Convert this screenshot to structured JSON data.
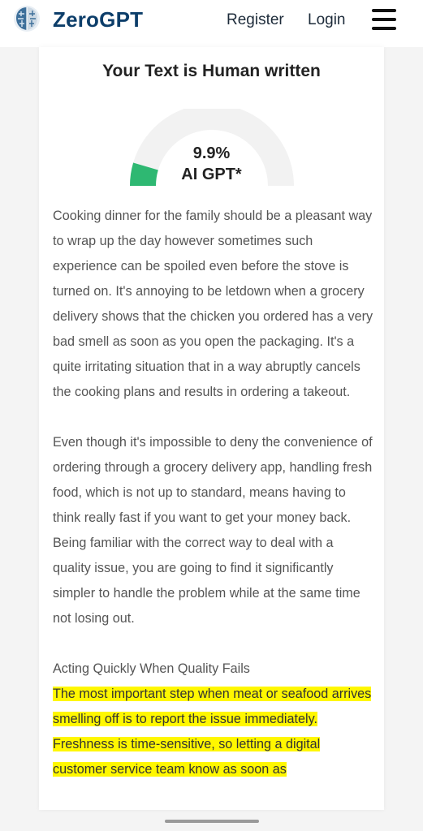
{
  "header": {
    "logo_icon": "brain-icon",
    "brand": "ZeroGPT",
    "register_label": "Register",
    "login_label": "Login",
    "menu_icon": "hamburger-menu-icon"
  },
  "result": {
    "title": "Your Text is Human written",
    "gauge_value_percent": 9.9,
    "percent_text": "9.9%",
    "gauge_label": "AI GPT*",
    "gauge_color": "#2eb872",
    "gauge_track_color": "#f2f2f2"
  },
  "content": {
    "paragraph1": "Cooking dinner for the family should be a pleasant way to wrap up the day however sometimes such experience can be spoiled even before the stove is turned on. It's annoying to be letdown when a grocery delivery shows that the chicken you ordered has a very bad smell as soon as you open the packaging. It's a quite irritating situation that in a way abruptly cancels the cooking plans and results in ordering a takeout.",
    "paragraph2": "Even though it's impossible to deny the convenience of ordering through a grocery delivery app, handling fresh food, which is not up to standard, means having to think really fast if you want to get your money back. Being familiar with the correct way to deal with a quality issue, you are going to find it significantly simpler to handle the problem while at the same time not losing out.",
    "section_heading": "Acting Quickly When Quality Fails",
    "highlight1": "The most important step when meat or seafood arrives smelling off is to report the issue immediately.",
    "highlight2": "Freshness is time-sensitive, so letting a digital customer service team know as soon as",
    "highlight_color": "#fff700"
  }
}
